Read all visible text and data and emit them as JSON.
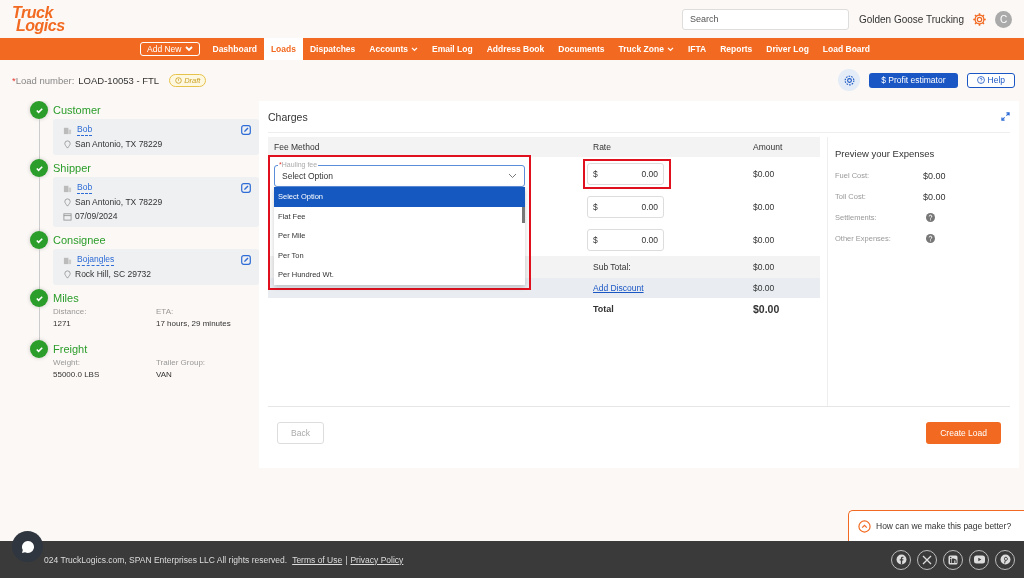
{
  "header": {
    "logo": [
      "Truck",
      "Logics"
    ],
    "search": {
      "placeholder": "Search"
    },
    "company": "Golden Goose Trucking",
    "avatar": "C"
  },
  "nav": {
    "add_new": "Add New",
    "items": [
      {
        "label": "Dashboard",
        "selected": false,
        "has_menu": false
      },
      {
        "label": "Loads",
        "selected": true,
        "has_menu": false
      },
      {
        "label": "Dispatches",
        "selected": false,
        "has_menu": false
      },
      {
        "label": "Accounts",
        "selected": false,
        "has_menu": true
      },
      {
        "label": "Email Log",
        "selected": false,
        "has_menu": false
      },
      {
        "label": "Address Book",
        "selected": false,
        "has_menu": false
      },
      {
        "label": "Documents",
        "selected": false,
        "has_menu": false
      },
      {
        "label": "Truck Zone",
        "selected": false,
        "has_menu": true
      },
      {
        "label": "IFTA",
        "selected": false,
        "has_menu": false
      },
      {
        "label": "Reports",
        "selected": false,
        "has_menu": false
      },
      {
        "label": "Driver Log",
        "selected": false,
        "has_menu": false
      },
      {
        "label": "Load Board",
        "selected": false,
        "has_menu": false
      }
    ]
  },
  "load": {
    "required_mark": "*",
    "label": "Load number:",
    "number": "LOAD-10053 - FTL",
    "status": "Draft",
    "profit_button": "$ Profit estimator",
    "help_button": "Help"
  },
  "steps": [
    {
      "kind": "card",
      "title": "Customer",
      "name": "Bob",
      "address": "San Antonio, TX 78229"
    },
    {
      "kind": "card",
      "title": "Shipper",
      "name": "Bob",
      "address": "San Antonio, TX 78229",
      "date": "07/09/2024"
    },
    {
      "kind": "card",
      "title": "Consignee",
      "name": "Bojangles",
      "address": "Rock Hill, SC 29732"
    },
    {
      "kind": "fields",
      "title": "Miles",
      "fields": [
        {
          "label": "Distance:",
          "value": "1271"
        },
        {
          "label": "ETA:",
          "value": "17 hours, 29 minutes"
        }
      ]
    },
    {
      "kind": "fields",
      "title": "Freight",
      "fields": [
        {
          "label": "Weight:",
          "value": "55000.0 LBS"
        },
        {
          "label": "Trailer Group:",
          "value": "VAN"
        }
      ]
    }
  ],
  "charges": {
    "title": "Charges",
    "columns": [
      "Fee Method",
      "Rate",
      "Amount"
    ],
    "fee_select": {
      "required_mark": "*",
      "label": "Hauling fee",
      "value": "Select Option",
      "highlighted": true,
      "options": [
        {
          "label": "Select Option",
          "selected": true
        },
        {
          "label": "Flat Fee",
          "selected": false
        },
        {
          "label": "Per Mile",
          "selected": false
        },
        {
          "label": "Per Ton",
          "selected": false
        },
        {
          "label": "Per Hundred Wt.",
          "selected": false
        }
      ]
    },
    "rows": [
      {
        "currency": "$",
        "rate": "0.00",
        "amount": "$0.00",
        "highlighted": true
      },
      {
        "currency": "$",
        "rate": "0.00",
        "amount": "$0.00",
        "highlighted": false
      },
      {
        "currency": "$",
        "rate": "0.00",
        "amount": "$0.00",
        "highlighted": false
      }
    ],
    "subtotal": {
      "label": "Sub Total:",
      "amount": "$0.00"
    },
    "discount": {
      "label": "Add Discount",
      "amount": "$0.00"
    },
    "total": {
      "label": "Total",
      "amount": "$0.00"
    }
  },
  "preview": {
    "title": "Preview your Expenses",
    "items": [
      {
        "label": "Fuel Cost:",
        "value": "$0.00"
      },
      {
        "label": "Toll Cost:",
        "value": "$0.00"
      },
      {
        "label": "Settlements:"
      },
      {
        "label": "Other Expenses:"
      }
    ]
  },
  "buttons": {
    "back": "Back",
    "create": "Create Load"
  },
  "feedback": "How can we make this page better?",
  "footer": {
    "copyright": "024 TruckLogics.com, SPAN Enterprises LLC All rights reserved.",
    "links": [
      "Terms of Use",
      "Privacy Policy"
    ],
    "separator": "|"
  }
}
